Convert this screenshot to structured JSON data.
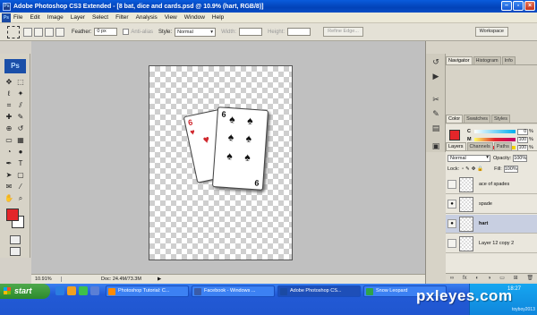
{
  "window": {
    "title": "Adobe Photoshop CS3 Extended - [8 bat, dice and cards.psd @ 10.9% (hart, RGB/8)]",
    "app_icon": "Ps",
    "controls": [
      "minimize",
      "maximize",
      "close"
    ]
  },
  "menu": {
    "items": [
      "File",
      "Edit",
      "Image",
      "Layer",
      "Select",
      "Filter",
      "Analysis",
      "View",
      "Window",
      "Help"
    ]
  },
  "options": {
    "feather_label": "Feather:",
    "feather_value": "0 px",
    "antialias_label": "Anti-alias",
    "style_label": "Style:",
    "style_value": "Normal",
    "width_label": "Width:",
    "height_label": "Height:",
    "refine_label": "Refine Edge...",
    "workspace_label": "Workspace"
  },
  "toolbox": {
    "logo": "Ps",
    "tools": [
      "move-tool",
      "marquee-tool",
      "lasso-tool",
      "magic-wand-tool",
      "crop-tool",
      "slice-tool",
      "healing-brush-tool",
      "brush-tool",
      "clone-stamp-tool",
      "history-brush-tool",
      "eraser-tool",
      "gradient-tool",
      "blur-tool",
      "dodge-tool",
      "pen-tool",
      "type-tool",
      "path-selection-tool",
      "shape-tool",
      "notes-tool",
      "eyedropper-tool",
      "hand-tool",
      "zoom-tool"
    ],
    "tool_glyphs": [
      "✥",
      "⬚",
      "ℓ",
      "✦",
      "⌗",
      "⫽",
      "✚",
      "✎",
      "⊕",
      "↺",
      "▭",
      "▦",
      "◔",
      "●",
      "✒",
      "T",
      "➤",
      "▢",
      "✉",
      "⁄",
      "✋",
      "⌕"
    ],
    "foreground_color": "#e3262a",
    "background_color": "#ffffff"
  },
  "canvas": {
    "card_back_rank": "6",
    "card_back_suit": "♥",
    "card_front_rank_top": "6",
    "card_front_rank_bottom": "9",
    "card_front_suit": "♠"
  },
  "status": {
    "zoom": "10.91%",
    "doc_info": "Doc: 24.4M/73.3M",
    "arrow": "▶"
  },
  "panels": {
    "top_tabs": [
      "Navigator",
      "Histogram",
      "Info"
    ],
    "color_tabs": [
      "Color",
      "Swatches",
      "Styles"
    ],
    "color_rows": [
      {
        "label": "C",
        "value": "0",
        "unit": "%",
        "gradient": "linear-gradient(90deg,#ffffff,#00aeef)"
      },
      {
        "label": "M",
        "value": "100",
        "unit": "%",
        "gradient": "linear-gradient(90deg,#ffff66,#e3262a,#c0006a)"
      },
      {
        "label": "Y",
        "value": "100",
        "unit": "%",
        "gradient": "linear-gradient(90deg,#e030a0,#e3262a,#f0e000)"
      },
      {
        "label": "K",
        "value": "0",
        "unit": "%",
        "gradient": "linear-gradient(90deg,#e3262a,#200000)"
      }
    ],
    "layers_tabs": [
      "Layers",
      "Channels",
      "Paths"
    ],
    "blend_mode": "Normal",
    "opacity_label": "Opacity:",
    "opacity_value": "100%",
    "lock_label": "Lock:",
    "fill_label": "Fill:",
    "fill_value": "100%",
    "layers": [
      {
        "name": "ace of spades",
        "visible": false,
        "selected": false
      },
      {
        "name": "spade",
        "visible": true,
        "selected": false
      },
      {
        "name": "hart",
        "visible": true,
        "selected": true
      },
      {
        "name": "Layer 12 copy 2",
        "visible": false,
        "selected": false
      }
    ],
    "bottom_icons": [
      "∞",
      "fx",
      "◐",
      "◑",
      "▭",
      "⊞",
      "🗑"
    ]
  },
  "taskbar": {
    "start_label": "start",
    "buttons": [
      {
        "label": "Photoshop Tutorial: C...",
        "active": false,
        "color": "#ff8a00"
      },
      {
        "label": "Facebook - Windows ...",
        "active": false,
        "color": "#3b5ca8"
      },
      {
        "label": "Adobe Photoshop CS...",
        "active": true,
        "color": "#1b4aa3"
      },
      {
        "label": "Snow Leopard",
        "active": false,
        "color": "#2ea34a"
      }
    ],
    "clock": "18:27",
    "watermark": "pxleyes.com",
    "watermark_sub": "toyboy2013"
  },
  "colors": {
    "accent_title": "#0242b8",
    "foreground": "#e3262a",
    "selected_layer": "#c8cfe1"
  }
}
